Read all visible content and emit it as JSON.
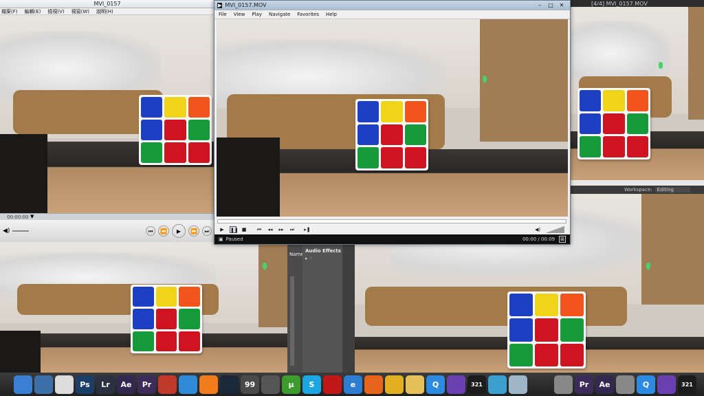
{
  "topleft_player": {
    "title": "MVI_0157",
    "menu": [
      "檔案(F)",
      "編輯(E)",
      "檢視(V)",
      "視窗(W)",
      "說明(H)"
    ],
    "timecode": "00:00:00"
  },
  "main_player": {
    "title": "MVI_0157.MOV",
    "menu": [
      "File",
      "View",
      "Play",
      "Navigate",
      "Favorites",
      "Help"
    ],
    "status": "Paused",
    "time": "00:00 / 00:09"
  },
  "topright_player": {
    "title": "[4/4] MVI_0157.MOV",
    "workspace_label": "Workspace:",
    "workspace_value": "Editing"
  },
  "premiere_panel": {
    "name_header": "Name",
    "audio_effects_title": "Audio Effects"
  },
  "taskbar": {
    "icons": [
      {
        "name": "start-orb-icon",
        "label": "",
        "color": "#3b7fd4"
      },
      {
        "name": "computer-icon",
        "label": "",
        "color": "#3c6fa8"
      },
      {
        "name": "clock-icon",
        "label": "",
        "color": "#dcdcdc"
      },
      {
        "name": "photoshop-icon",
        "label": "Ps",
        "color": "#1b3f66"
      },
      {
        "name": "lightroom-icon",
        "label": "Lr",
        "color": "#2a3140"
      },
      {
        "name": "after-effects-icon",
        "label": "Ae",
        "color": "#33284f"
      },
      {
        "name": "premiere-icon",
        "label": "Pr",
        "color": "#3d2b5a"
      },
      {
        "name": "game-icon",
        "label": "",
        "color": "#c0392b"
      },
      {
        "name": "itunes-icon",
        "label": "",
        "color": "#2f8bd8"
      },
      {
        "name": "origin-icon",
        "label": "",
        "color": "#f07c1c"
      },
      {
        "name": "steam-icon",
        "label": "",
        "color": "#1b2838"
      },
      {
        "name": "game-99-icon",
        "label": "99",
        "color": "#4a4a4a"
      },
      {
        "name": "monitor-icon",
        "label": "",
        "color": "#555"
      },
      {
        "name": "utorrent-icon",
        "label": "µ",
        "color": "#3d9a2c"
      },
      {
        "name": "skype-icon",
        "label": "S",
        "color": "#1ca7e2"
      },
      {
        "name": "media-player-icon",
        "label": "",
        "color": "#c01818"
      },
      {
        "name": "ie-icon",
        "label": "e",
        "color": "#2c7cd1"
      },
      {
        "name": "firefox-icon",
        "label": "",
        "color": "#e8641c"
      },
      {
        "name": "chrome-icon",
        "label": "",
        "color": "#e0b020"
      },
      {
        "name": "folder-icon",
        "label": "",
        "color": "#e6c05a"
      },
      {
        "name": "quicktime-icon",
        "label": "Q",
        "color": "#2c8be0"
      },
      {
        "name": "visual-studio-icon",
        "label": "",
        "color": "#6a3fb0"
      },
      {
        "name": "media-player-classic-icon",
        "label": "321",
        "color": "#1c1c1c"
      },
      {
        "name": "tools-icon",
        "label": "",
        "color": "#3aa0d0"
      },
      {
        "name": "recycle-bin-icon",
        "label": "",
        "color": "#9fb6c8"
      },
      {
        "name": "keyboard-icon",
        "label": "",
        "color": "#888"
      },
      {
        "name": "premiere-icon-2",
        "label": "Pr",
        "color": "#3d2b5a"
      },
      {
        "name": "after-effects-icon-2",
        "label": "Ae",
        "color": "#33284f"
      },
      {
        "name": "keyboard-icon-2",
        "label": "",
        "color": "#888"
      },
      {
        "name": "quicktime-icon-2",
        "label": "Q",
        "color": "#2c8be0"
      },
      {
        "name": "visual-studio-icon-2",
        "label": "",
        "color": "#6a3fb0"
      },
      {
        "name": "media-player-classic-icon-2",
        "label": "321",
        "color": "#1c1c1c"
      }
    ]
  }
}
